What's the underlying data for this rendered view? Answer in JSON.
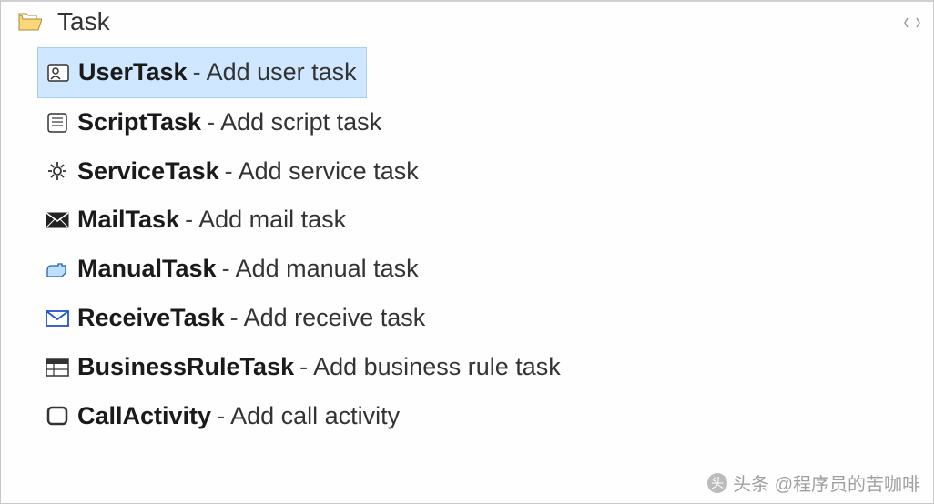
{
  "header": {
    "title": "Task"
  },
  "items": [
    {
      "name": "UserTask",
      "desc": "Add user task",
      "icon": "user-task-icon",
      "selected": true
    },
    {
      "name": "ScriptTask",
      "desc": "Add script task",
      "icon": "script-task-icon",
      "selected": false
    },
    {
      "name": "ServiceTask",
      "desc": "Add service task",
      "icon": "service-task-icon",
      "selected": false
    },
    {
      "name": "MailTask",
      "desc": "Add mail task",
      "icon": "mail-task-icon",
      "selected": false
    },
    {
      "name": "ManualTask",
      "desc": "Add manual task",
      "icon": "manual-task-icon",
      "selected": false
    },
    {
      "name": "ReceiveTask",
      "desc": "Add receive task",
      "icon": "receive-task-icon",
      "selected": false
    },
    {
      "name": "BusinessRuleTask",
      "desc": "Add business rule task",
      "icon": "business-rule-task-icon",
      "selected": false
    },
    {
      "name": "CallActivity",
      "desc": "Add call activity",
      "icon": "call-activity-icon",
      "selected": false
    }
  ],
  "watermark": {
    "text": "头条 @程序员的苦咖啡"
  }
}
